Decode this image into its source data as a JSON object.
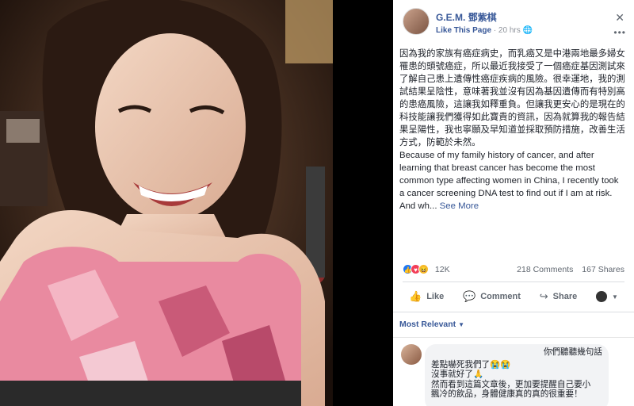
{
  "photo": {
    "alt_subject": "smiling woman in pink camouflage sports top at gym"
  },
  "page": {
    "name": "G.E.M. 鄧紫棋",
    "like_label": "Like This Page",
    "time": "20 hrs",
    "close": "✕",
    "more": "•••"
  },
  "post": {
    "chinese": "因為我的家族有癌症病史，而乳癌又是中港兩地最多婦女罹患的頭號癌症，所以最近我接受了一個癌症基因測試來了解自己患上遺傳性癌症疾病的風險。很幸運地，我的測試結果呈陰性，意味著我並沒有因為基因遺傳而有特別高的患癌風險，這讓我如釋重負。但讓我更安心的是現在的科技能讓我們獲得如此寶貴的資訊，因為就算我的報告結果呈陽性，我也寧願及早知道並採取預防措施，改善生活方式，防範於未然。",
    "english": "Because of my family history of cancer, and after learning that breast cancer has become the most common type affecting women in China, I recently took a cancer screening DNA test to find out if I am at risk. And wh...",
    "see_more": "See More"
  },
  "reactions": {
    "count": "12K",
    "comments": "218 Comments",
    "shares": "167 Shares",
    "icons": [
      "like-reaction",
      "love-reaction",
      "haha-reaction"
    ]
  },
  "actions": {
    "like": "Like",
    "comment": "Comment",
    "share": "Share"
  },
  "comments": {
    "sort_label": "Most Relevant",
    "first": {
      "line1": "你們聽聽幾句話",
      "line2": "差點嚇死我們了😭😭",
      "line3": "沒事就好了🙏",
      "line4": "然而看到這篇文章後，更加要提醒自己要小",
      "line5": "飄冷的飲品，身體健康真的真的很重要！"
    }
  },
  "colors": {
    "brand": "#385898",
    "like": "#2078f4",
    "love": "#f33e58",
    "haha": "#f7b928",
    "top_pink": "#e98aa0"
  }
}
